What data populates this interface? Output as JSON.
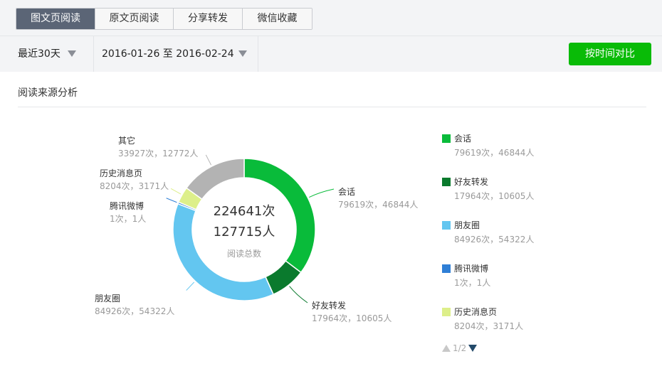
{
  "tabs": [
    {
      "label": "图文页阅读",
      "active": true
    },
    {
      "label": "原文页阅读",
      "active": false
    },
    {
      "label": "分享转发",
      "active": false
    },
    {
      "label": "微信收藏",
      "active": false
    }
  ],
  "filters": {
    "period": "最近30天",
    "date_range": "2016-01-26 至 2016-02-24",
    "compare_button": "按时间对比"
  },
  "section": {
    "title": "阅读来源分析"
  },
  "chart_data": {
    "type": "pie",
    "center": {
      "total_reads": "224641次",
      "total_users": "127715人",
      "caption": "阅读总数"
    },
    "slices": [
      {
        "name": "会话",
        "reads": 79619,
        "users": 46844,
        "value_text": "79619次，46844人",
        "color": "#09bb3a"
      },
      {
        "name": "好友转发",
        "reads": 17964,
        "users": 10605,
        "value_text": "17964次，10605人",
        "color": "#0a7a2d"
      },
      {
        "name": "朋友圈",
        "reads": 84926,
        "users": 54322,
        "value_text": "84926次，54322人",
        "color": "#63c6f0"
      },
      {
        "name": "腾讯微博",
        "reads": 1,
        "users": 1,
        "value_text": "1次，1人",
        "color": "#2f7fd6"
      },
      {
        "name": "历史消息页",
        "reads": 8204,
        "users": 3171,
        "value_text": "8204次，3171人",
        "color": "#ddef8a"
      },
      {
        "name": "其它",
        "reads": 33927,
        "users": 12772,
        "value_text": "33927次，12772人",
        "color": "#b3b3b3"
      }
    ]
  },
  "legend_visible": [
    0,
    1,
    2,
    3,
    4
  ],
  "pager": {
    "text": "1/2"
  },
  "colors": {
    "accent": "#09bb07",
    "tab_active": "#5b6576"
  }
}
